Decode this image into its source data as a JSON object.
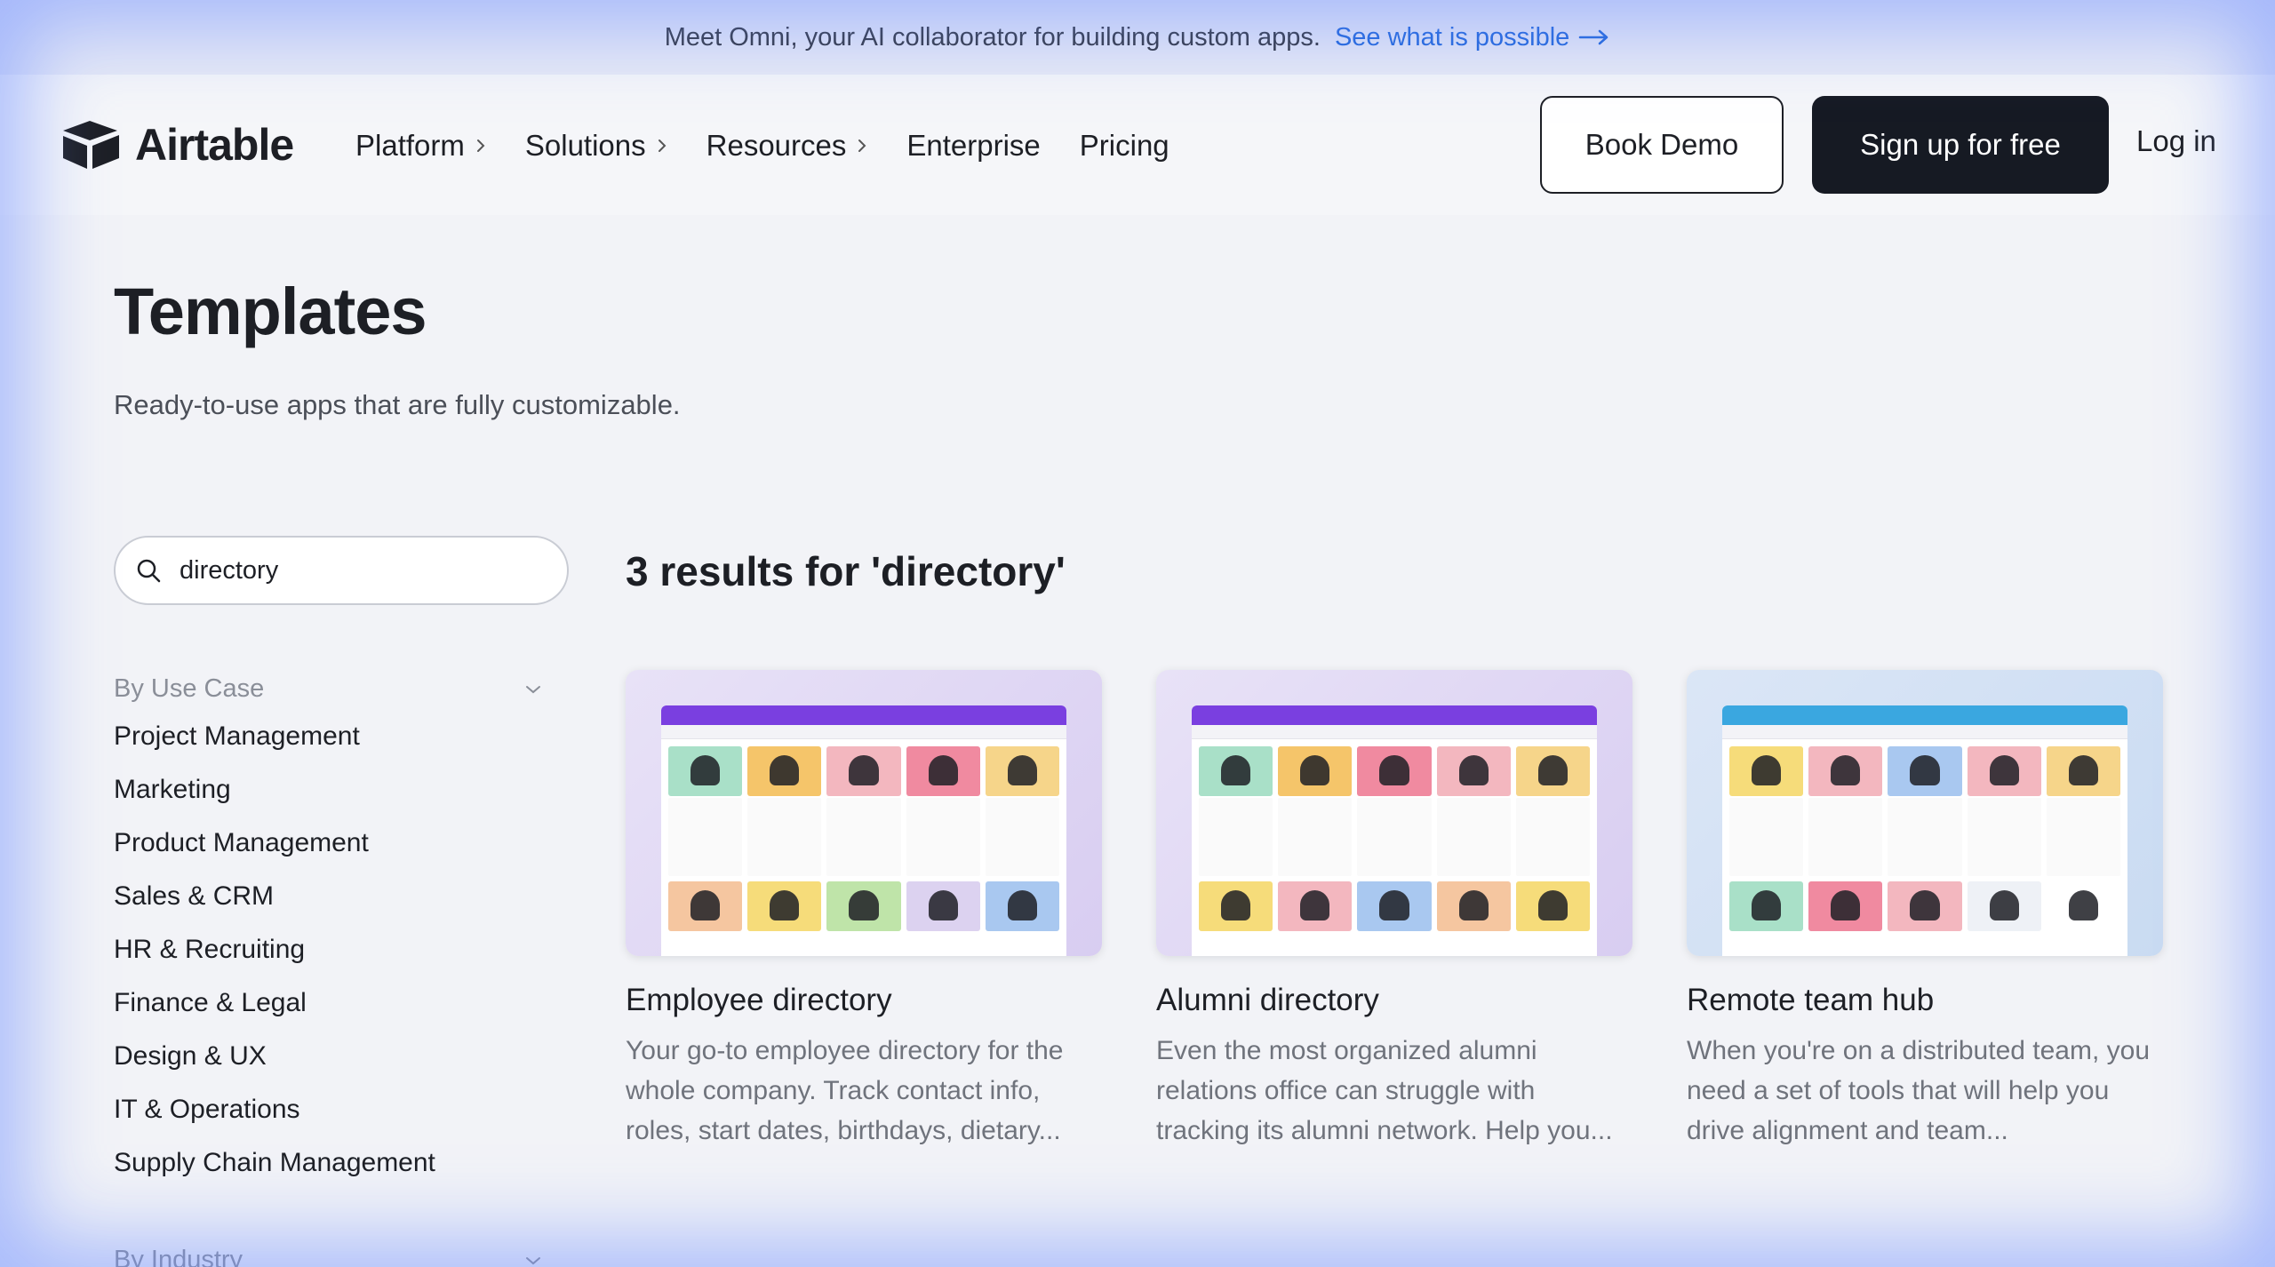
{
  "banner": {
    "text": "Meet Omni, your AI collaborator for building custom apps.",
    "link": "See what is possible"
  },
  "nav": {
    "logo": "Airtable",
    "items": [
      {
        "label": "Platform",
        "has_chevron": true
      },
      {
        "label": "Solutions",
        "has_chevron": true
      },
      {
        "label": "Resources",
        "has_chevron": true
      },
      {
        "label": "Enterprise",
        "has_chevron": false
      },
      {
        "label": "Pricing",
        "has_chevron": false
      }
    ],
    "book_demo": "Book Demo",
    "sign_up": "Sign up for free",
    "log_in": "Log in"
  },
  "hero": {
    "title": "Templates",
    "subtitle": "Ready-to-use apps that are fully customizable."
  },
  "search": {
    "value": "directory"
  },
  "sidebar": {
    "use_case_heading": "By Use Case",
    "use_cases": [
      "Project Management",
      "Marketing",
      "Product Management",
      "Sales & CRM",
      "HR & Recruiting",
      "Finance & Legal",
      "Design & UX",
      "IT & Operations",
      "Supply Chain Management"
    ],
    "industry_heading": "By Industry"
  },
  "results": {
    "title": "3 results for 'directory'",
    "cards": [
      {
        "name": "Employee directory",
        "description": "Your go-to employee directory for the whole company. Track contact info, roles, start dates, birthdays, dietary..."
      },
      {
        "name": "Alumni directory",
        "description": "Even the most organized alumni relations office can struggle with tracking its alumni network. Help you..."
      },
      {
        "name": "Remote team hub",
        "description": "When you're on a distributed team, you need a set of tools that will help you drive alignment and team..."
      }
    ]
  },
  "colors": {
    "link_blue": "#1f66d9",
    "signup_bg": "#161a23",
    "edge_glow": "#6c8cff"
  }
}
